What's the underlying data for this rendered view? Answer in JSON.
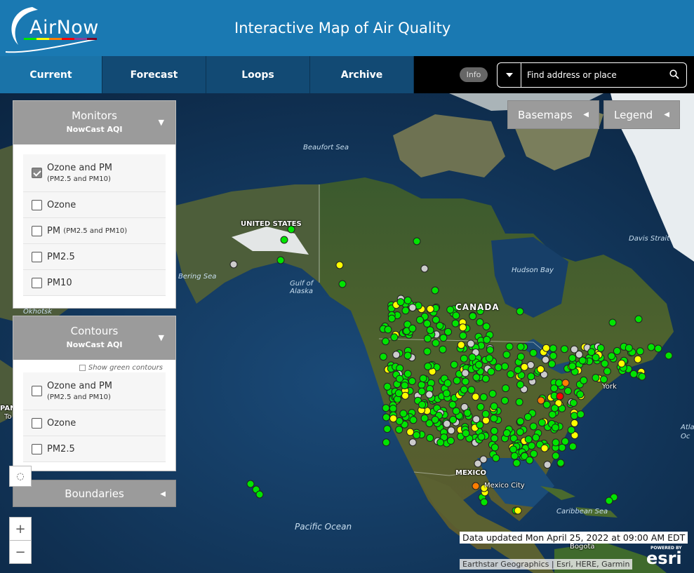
{
  "header": {
    "logo_text": "AirNow",
    "title": "Interactive Map of Air Quality"
  },
  "nav": {
    "tabs": [
      {
        "label": "Current",
        "active": true
      },
      {
        "label": "Forecast",
        "active": false
      },
      {
        "label": "Loops",
        "active": false
      },
      {
        "label": "Archive",
        "active": false
      }
    ],
    "info_label": "Info",
    "search_placeholder": "Find address or place"
  },
  "buttons": {
    "basemaps": "Basemaps",
    "legend": "Legend"
  },
  "monitors": {
    "title": "Monitors",
    "subtitle": "NowCast AQI",
    "options": [
      {
        "label": "Ozone and PM",
        "sub": "(PM2.5 and PM10)",
        "checked": true
      },
      {
        "label": "Ozone",
        "sub": "",
        "checked": false
      },
      {
        "label": "PM",
        "sub": "(PM2.5 and PM10)",
        "checked": false
      },
      {
        "label": "PM2.5",
        "sub": "",
        "checked": false
      },
      {
        "label": "PM10",
        "sub": "",
        "checked": false
      }
    ]
  },
  "contours": {
    "title": "Contours",
    "subtitle": "NowCast AQI",
    "green_toggle": "Show green contours",
    "options": [
      {
        "label": "Ozone and PM",
        "sub": "(PM2.5 and PM10)",
        "checked": false
      },
      {
        "label": "Ozone",
        "sub": "",
        "checked": false
      },
      {
        "label": "PM2.5",
        "sub": "",
        "checked": false
      }
    ]
  },
  "boundaries": {
    "title": "Boundaries"
  },
  "map_labels": {
    "beaufort": "Beaufort Sea",
    "bering": "Bering Sea",
    "alaska_gulf": "Gulf of\nAlaska",
    "hudson": "Hudson Bay",
    "davis": "Davis Strait",
    "pacific": "Pacific Ocean",
    "caribbean": "Caribbean Sea",
    "okhotsk": "Okhotsk",
    "atlantic": "Atla\nOc",
    "canada": "CANADA",
    "us": "UNITED STATES",
    "mexico": "MEXICO",
    "mexico_city": "Mexico City",
    "york": "York",
    "bogota": "Bogota",
    "pan": "PAN",
    "to": "To"
  },
  "footer": {
    "updated": "Data updated Mon April 25, 2022 at 09:00 AM EDT",
    "attribution": "Earthstar Geographics | Esri, HERE, Garmin",
    "powered": "POWERED BY",
    "esri": "esri"
  },
  "colors": {
    "good": "#00e400",
    "moderate": "#ffff00",
    "usg": "#ff7e00",
    "unhealthy": "#ff0000",
    "no_data": "#cccccc",
    "header": "#1a79b2"
  }
}
